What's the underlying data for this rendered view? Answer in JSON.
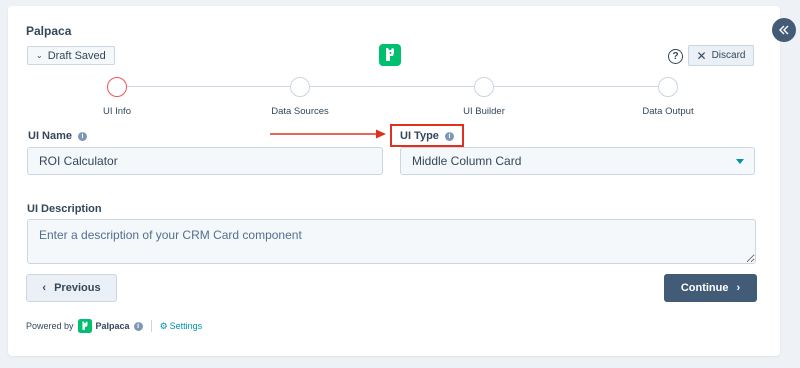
{
  "app": {
    "title": "Palpaca"
  },
  "header": {
    "draft_label": "Draft Saved",
    "help_label": "?",
    "discard_label": "Discard"
  },
  "stepper": {
    "steps": [
      {
        "label": "UI Info",
        "active": true
      },
      {
        "label": "Data Sources",
        "active": false
      },
      {
        "label": "UI Builder",
        "active": false
      },
      {
        "label": "Data Output",
        "active": false
      }
    ]
  },
  "form": {
    "ui_name": {
      "label": "UI Name",
      "value": "ROI Calculator"
    },
    "ui_type": {
      "label": "UI Type",
      "value": "Middle Column Card"
    },
    "ui_description": {
      "label": "UI Description",
      "placeholder": "Enter a description of your CRM Card component"
    }
  },
  "nav": {
    "previous_label": "Previous",
    "continue_label": "Continue"
  },
  "footer": {
    "powered_by": "Powered by",
    "brand": "Palpaca",
    "settings_label": "Settings"
  },
  "colors": {
    "accent": "#425b76",
    "active_step": "#f2545b",
    "link": "#0091ae",
    "highlight": "#e0301e",
    "logo_green": "#00bf6f"
  }
}
